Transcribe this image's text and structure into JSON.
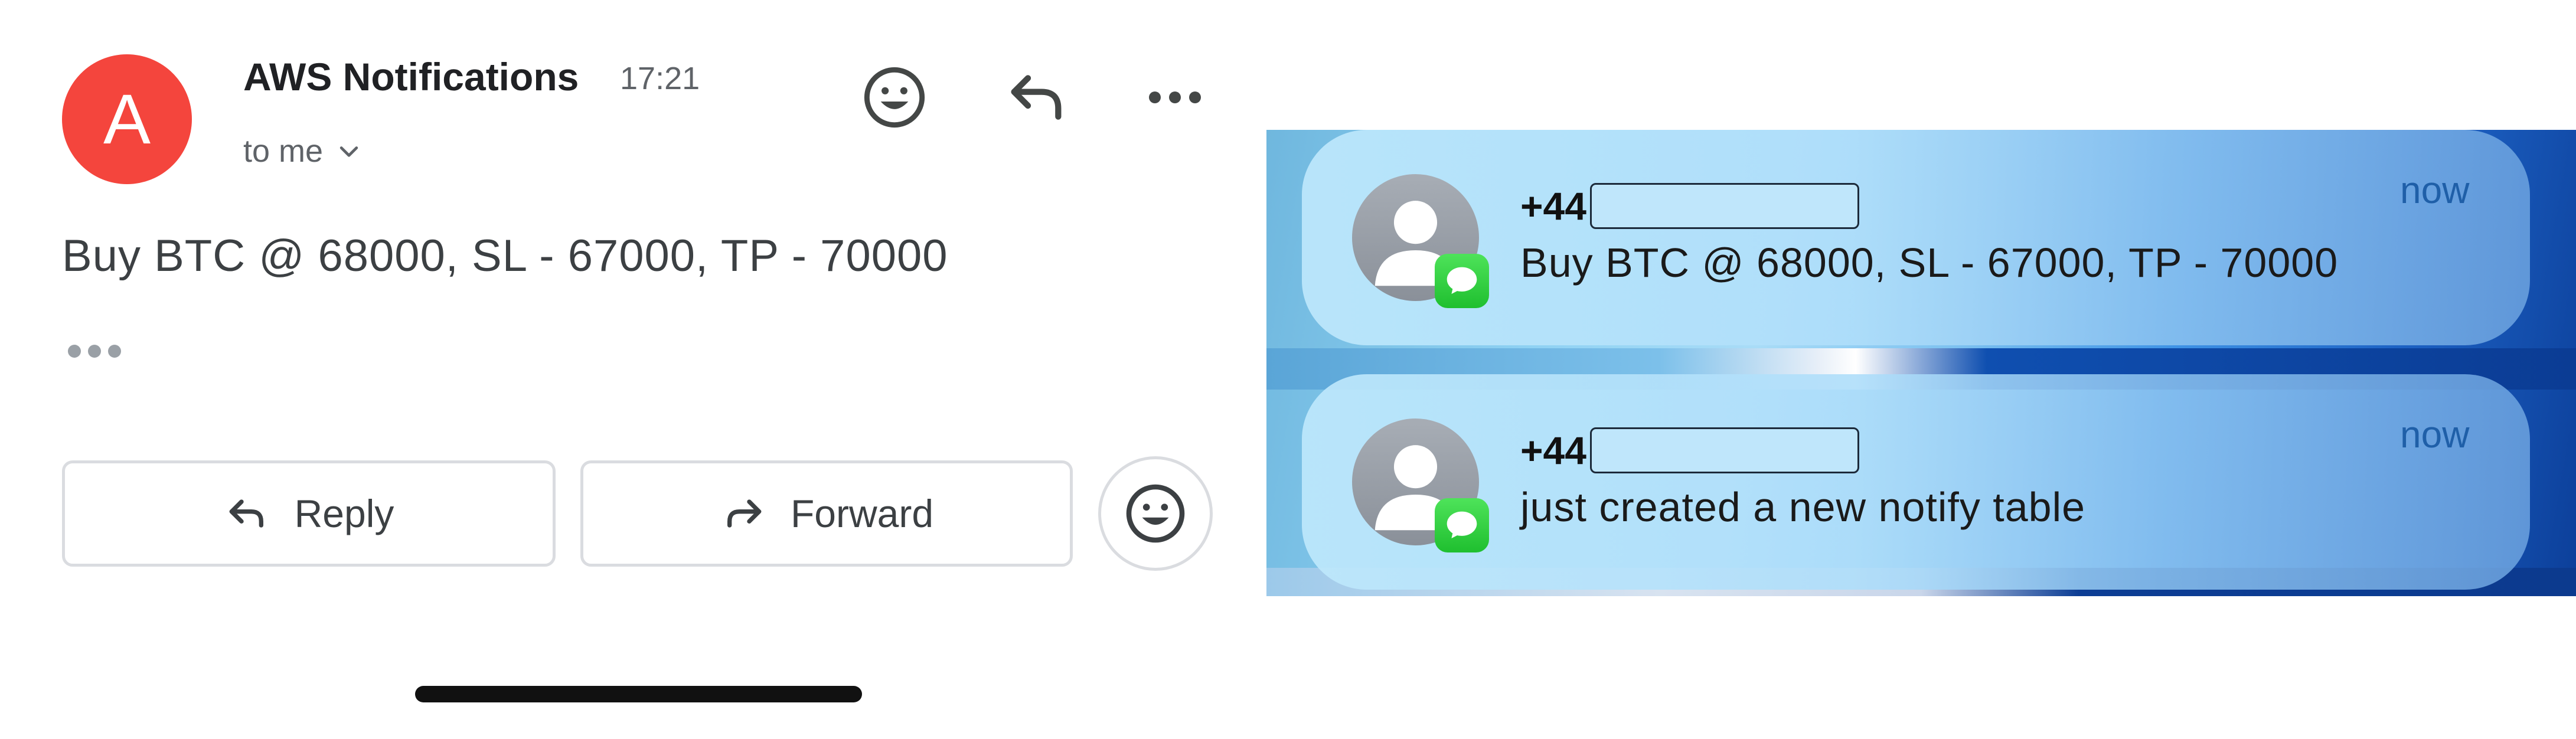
{
  "email": {
    "avatar_letter": "A",
    "sender": "AWS Notifications",
    "time": "17:21",
    "recipient": "to me",
    "body": "Buy BTC @ 68000, SL - 67000, TP - 70000",
    "reply_label": "Reply",
    "forward_label": "Forward",
    "icons": [
      "chevron-down-icon",
      "emoji-icon",
      "reply-icon",
      "more-icon",
      "ellipsis-icon",
      "forward-icon"
    ],
    "colors": {
      "avatar": "#f4453d",
      "text": "#3c4043"
    }
  },
  "notifications": [
    {
      "sender": "+44",
      "sender_redacted": true,
      "time": "now",
      "message": "Buy BTC @ 68000, SL - 67000, TP - 70000",
      "app_icon": "messages-icon"
    },
    {
      "sender": "+44",
      "sender_redacted": true,
      "time": "now",
      "message": "just created a new notify table",
      "app_icon": "messages-icon"
    }
  ]
}
